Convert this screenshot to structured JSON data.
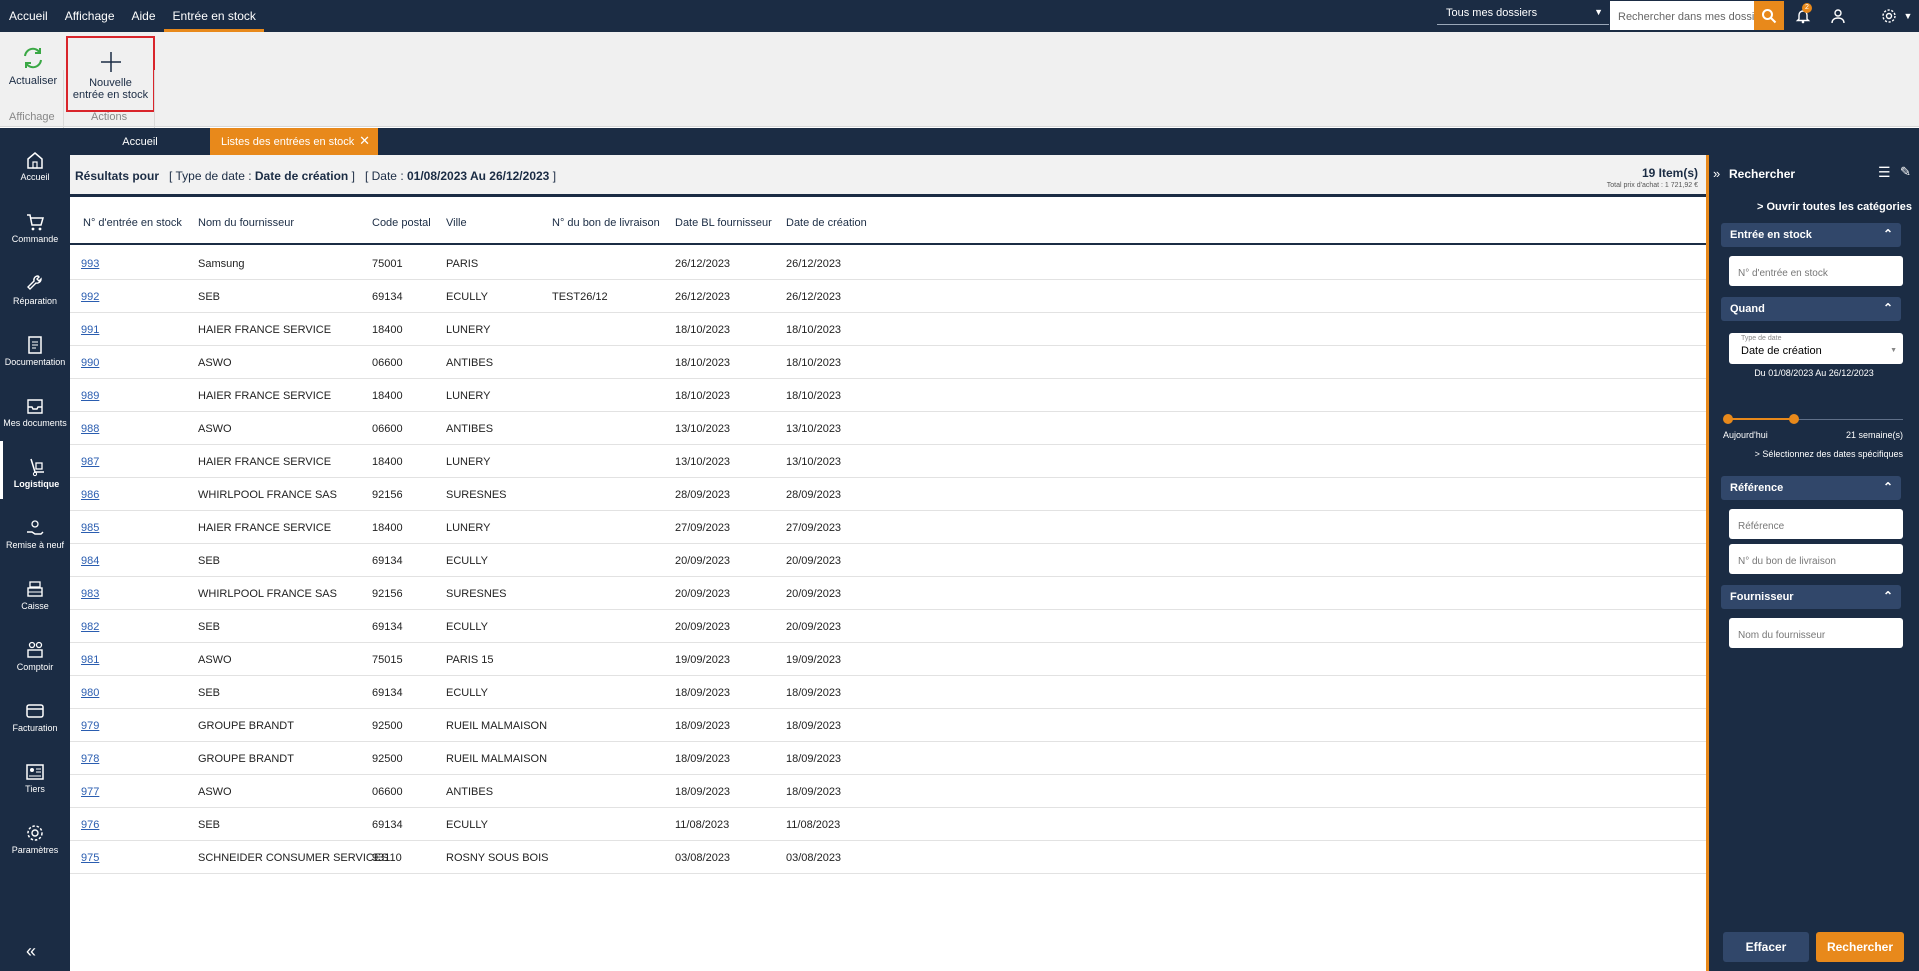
{
  "menu": [
    "Accueil",
    "Affichage",
    "Aide",
    "Entrée en stock"
  ],
  "top": {
    "dossier": "Tous mes dossiers",
    "search_placeholder": "Rechercher dans mes dossiers",
    "badge": "2"
  },
  "ribbon": {
    "refresh": "Actualiser",
    "new1": "Nouvelle",
    "new2": "entrée en stock",
    "group1": "Affichage",
    "group2": "Actions"
  },
  "sidebar": [
    "Accueil",
    "Commande",
    "Réparation",
    "Documentation",
    "Mes documents",
    "Logistique",
    "Remise à neuf",
    "Caisse",
    "Comptoir",
    "Facturation",
    "Tiers",
    "Paramètres"
  ],
  "tabs": {
    "home": "Accueil",
    "list": "Listes des entrées en stock"
  },
  "results": {
    "prefix": "Résultats pour",
    "date_type_label": "[ Type de date :",
    "date_type": "Date de création",
    "close_bracket": "]",
    "date_label": "[ Date :",
    "date_range": "01/08/2023 Au 26/12/2023",
    "date_close": "]",
    "count": "19 Item(s)",
    "total": "Total prix d'achat : 1 721,92 €"
  },
  "columns": [
    "N° d'entrée en stock",
    "Nom du fournisseur",
    "Code postal",
    "Ville",
    "N° du bon de livraison",
    "Date BL fournisseur",
    "Date de création"
  ],
  "rows": [
    [
      "993",
      "Samsung",
      "75001",
      "PARIS",
      "",
      "26/12/2023",
      "26/12/2023"
    ],
    [
      "992",
      "SEB",
      "69134",
      "ECULLY",
      "TEST26/12",
      "26/12/2023",
      "26/12/2023"
    ],
    [
      "991",
      "HAIER FRANCE SERVICE",
      "18400",
      "LUNERY",
      "",
      "18/10/2023",
      "18/10/2023"
    ],
    [
      "990",
      "ASWO",
      "06600",
      "ANTIBES",
      "",
      "18/10/2023",
      "18/10/2023"
    ],
    [
      "989",
      "HAIER FRANCE SERVICE",
      "18400",
      "LUNERY",
      "",
      "18/10/2023",
      "18/10/2023"
    ],
    [
      "988",
      "ASWO",
      "06600",
      "ANTIBES",
      "",
      "13/10/2023",
      "13/10/2023"
    ],
    [
      "987",
      "HAIER FRANCE SERVICE",
      "18400",
      "LUNERY",
      "",
      "13/10/2023",
      "13/10/2023"
    ],
    [
      "986",
      "WHIRLPOOL FRANCE SAS",
      "92156",
      "SURESNES",
      "",
      "28/09/2023",
      "28/09/2023"
    ],
    [
      "985",
      "HAIER FRANCE SERVICE",
      "18400",
      "LUNERY",
      "",
      "27/09/2023",
      "27/09/2023"
    ],
    [
      "984",
      "SEB",
      "69134",
      "ECULLY",
      "",
      "20/09/2023",
      "20/09/2023"
    ],
    [
      "983",
      "WHIRLPOOL FRANCE SAS",
      "92156",
      "SURESNES",
      "",
      "20/09/2023",
      "20/09/2023"
    ],
    [
      "982",
      "SEB",
      "69134",
      "ECULLY",
      "",
      "20/09/2023",
      "20/09/2023"
    ],
    [
      "981",
      "ASWO",
      "75015",
      "PARIS 15",
      "",
      "19/09/2023",
      "19/09/2023"
    ],
    [
      "980",
      "SEB",
      "69134",
      "ECULLY",
      "",
      "18/09/2023",
      "18/09/2023"
    ],
    [
      "979",
      "GROUPE BRANDT",
      "92500",
      "RUEIL MALMAISON",
      "",
      "18/09/2023",
      "18/09/2023"
    ],
    [
      "978",
      "GROUPE BRANDT",
      "92500",
      "RUEIL MALMAISON",
      "",
      "18/09/2023",
      "18/09/2023"
    ],
    [
      "977",
      "ASWO",
      "06600",
      "ANTIBES",
      "",
      "18/09/2023",
      "18/09/2023"
    ],
    [
      "976",
      "SEB",
      "69134",
      "ECULLY",
      "",
      "11/08/2023",
      "11/08/2023"
    ],
    [
      "975",
      "SCHNEIDER CONSUMER SERVICES",
      "93110",
      "ROSNY SOUS BOIS",
      "",
      "03/08/2023",
      "03/08/2023"
    ]
  ],
  "panel": {
    "title": "Rechercher",
    "open_all": "Ouvrir toutes les catégories",
    "s1": "Entrée en stock",
    "f1": "N° d'entrée en stock",
    "s2": "Quand",
    "date_type_label": "Type de date",
    "date_type": "Date de création",
    "range": "Du 01/08/2023 Au 26/12/2023",
    "today": "Aujourd'hui",
    "weeks": "21 semaine(s)",
    "specific": "> Sélectionnez des dates spécifiques",
    "s3": "Référence",
    "f2": "Référence",
    "f3": "N° du bon de livraison",
    "s4": "Fournisseur",
    "f4": "Nom du fournisseur",
    "clear": "Effacer",
    "search": "Rechercher"
  }
}
